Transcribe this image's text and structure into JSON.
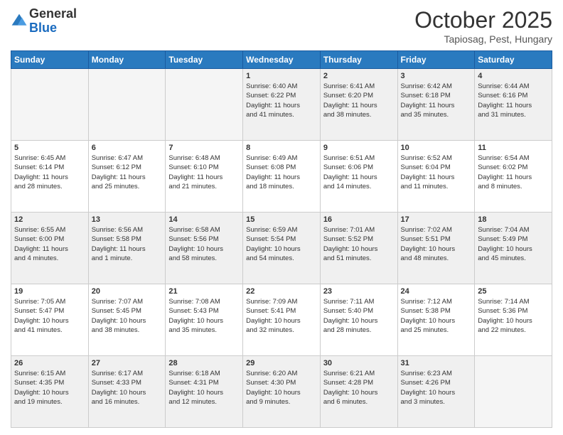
{
  "logo": {
    "general": "General",
    "blue": "Blue"
  },
  "header": {
    "month": "October 2025",
    "location": "Tapiosag, Pest, Hungary"
  },
  "days_of_week": [
    "Sunday",
    "Monday",
    "Tuesday",
    "Wednesday",
    "Thursday",
    "Friday",
    "Saturday"
  ],
  "weeks": [
    [
      {
        "day": "",
        "info": ""
      },
      {
        "day": "",
        "info": ""
      },
      {
        "day": "",
        "info": ""
      },
      {
        "day": "1",
        "info": "Sunrise: 6:40 AM\nSunset: 6:22 PM\nDaylight: 11 hours\nand 41 minutes."
      },
      {
        "day": "2",
        "info": "Sunrise: 6:41 AM\nSunset: 6:20 PM\nDaylight: 11 hours\nand 38 minutes."
      },
      {
        "day": "3",
        "info": "Sunrise: 6:42 AM\nSunset: 6:18 PM\nDaylight: 11 hours\nand 35 minutes."
      },
      {
        "day": "4",
        "info": "Sunrise: 6:44 AM\nSunset: 6:16 PM\nDaylight: 11 hours\nand 31 minutes."
      }
    ],
    [
      {
        "day": "5",
        "info": "Sunrise: 6:45 AM\nSunset: 6:14 PM\nDaylight: 11 hours\nand 28 minutes."
      },
      {
        "day": "6",
        "info": "Sunrise: 6:47 AM\nSunset: 6:12 PM\nDaylight: 11 hours\nand 25 minutes."
      },
      {
        "day": "7",
        "info": "Sunrise: 6:48 AM\nSunset: 6:10 PM\nDaylight: 11 hours\nand 21 minutes."
      },
      {
        "day": "8",
        "info": "Sunrise: 6:49 AM\nSunset: 6:08 PM\nDaylight: 11 hours\nand 18 minutes."
      },
      {
        "day": "9",
        "info": "Sunrise: 6:51 AM\nSunset: 6:06 PM\nDaylight: 11 hours\nand 14 minutes."
      },
      {
        "day": "10",
        "info": "Sunrise: 6:52 AM\nSunset: 6:04 PM\nDaylight: 11 hours\nand 11 minutes."
      },
      {
        "day": "11",
        "info": "Sunrise: 6:54 AM\nSunset: 6:02 PM\nDaylight: 11 hours\nand 8 minutes."
      }
    ],
    [
      {
        "day": "12",
        "info": "Sunrise: 6:55 AM\nSunset: 6:00 PM\nDaylight: 11 hours\nand 4 minutes."
      },
      {
        "day": "13",
        "info": "Sunrise: 6:56 AM\nSunset: 5:58 PM\nDaylight: 11 hours\nand 1 minute."
      },
      {
        "day": "14",
        "info": "Sunrise: 6:58 AM\nSunset: 5:56 PM\nDaylight: 10 hours\nand 58 minutes."
      },
      {
        "day": "15",
        "info": "Sunrise: 6:59 AM\nSunset: 5:54 PM\nDaylight: 10 hours\nand 54 minutes."
      },
      {
        "day": "16",
        "info": "Sunrise: 7:01 AM\nSunset: 5:52 PM\nDaylight: 10 hours\nand 51 minutes."
      },
      {
        "day": "17",
        "info": "Sunrise: 7:02 AM\nSunset: 5:51 PM\nDaylight: 10 hours\nand 48 minutes."
      },
      {
        "day": "18",
        "info": "Sunrise: 7:04 AM\nSunset: 5:49 PM\nDaylight: 10 hours\nand 45 minutes."
      }
    ],
    [
      {
        "day": "19",
        "info": "Sunrise: 7:05 AM\nSunset: 5:47 PM\nDaylight: 10 hours\nand 41 minutes."
      },
      {
        "day": "20",
        "info": "Sunrise: 7:07 AM\nSunset: 5:45 PM\nDaylight: 10 hours\nand 38 minutes."
      },
      {
        "day": "21",
        "info": "Sunrise: 7:08 AM\nSunset: 5:43 PM\nDaylight: 10 hours\nand 35 minutes."
      },
      {
        "day": "22",
        "info": "Sunrise: 7:09 AM\nSunset: 5:41 PM\nDaylight: 10 hours\nand 32 minutes."
      },
      {
        "day": "23",
        "info": "Sunrise: 7:11 AM\nSunset: 5:40 PM\nDaylight: 10 hours\nand 28 minutes."
      },
      {
        "day": "24",
        "info": "Sunrise: 7:12 AM\nSunset: 5:38 PM\nDaylight: 10 hours\nand 25 minutes."
      },
      {
        "day": "25",
        "info": "Sunrise: 7:14 AM\nSunset: 5:36 PM\nDaylight: 10 hours\nand 22 minutes."
      }
    ],
    [
      {
        "day": "26",
        "info": "Sunrise: 6:15 AM\nSunset: 4:35 PM\nDaylight: 10 hours\nand 19 minutes."
      },
      {
        "day": "27",
        "info": "Sunrise: 6:17 AM\nSunset: 4:33 PM\nDaylight: 10 hours\nand 16 minutes."
      },
      {
        "day": "28",
        "info": "Sunrise: 6:18 AM\nSunset: 4:31 PM\nDaylight: 10 hours\nand 12 minutes."
      },
      {
        "day": "29",
        "info": "Sunrise: 6:20 AM\nSunset: 4:30 PM\nDaylight: 10 hours\nand 9 minutes."
      },
      {
        "day": "30",
        "info": "Sunrise: 6:21 AM\nSunset: 4:28 PM\nDaylight: 10 hours\nand 6 minutes."
      },
      {
        "day": "31",
        "info": "Sunrise: 6:23 AM\nSunset: 4:26 PM\nDaylight: 10 hours\nand 3 minutes."
      },
      {
        "day": "",
        "info": ""
      }
    ]
  ]
}
